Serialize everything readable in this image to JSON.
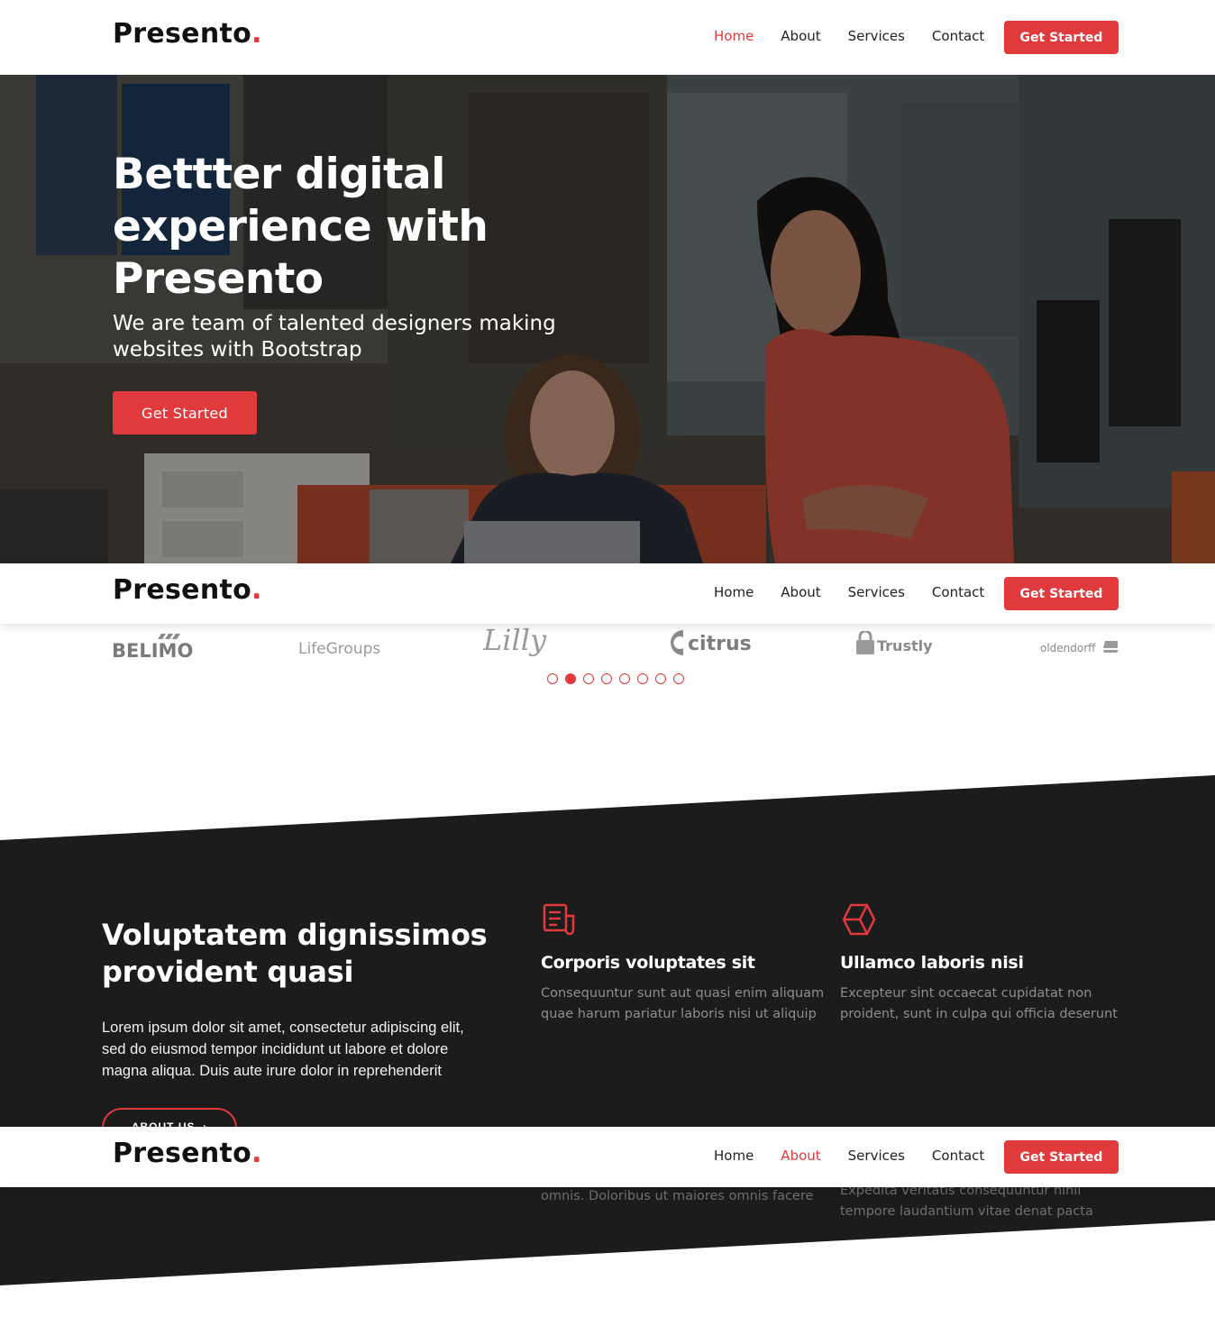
{
  "brand": {
    "name": "Presento",
    "dot": ".",
    "accent_color": "#e03a3c"
  },
  "headers": [
    {
      "nav": [
        "Home",
        "About",
        "Services",
        "Contact"
      ],
      "active": "Home",
      "cta": "Get Started"
    },
    {
      "nav": [
        "Home",
        "About",
        "Services",
        "Contact"
      ],
      "active": "",
      "cta": "Get Started"
    },
    {
      "nav": [
        "Home",
        "About",
        "Services",
        "Contact"
      ],
      "active": "About",
      "cta": "Get Started"
    }
  ],
  "hero": {
    "title": "Bettter digital experience with Presento",
    "subtitle": "We are team of talented designers making websites with Bootstrap",
    "cta": "Get Started"
  },
  "clients": {
    "logos": [
      "BELIMO",
      "LifeGroups",
      "Lilly",
      "citrus",
      "Trustly",
      "oldendorff"
    ],
    "slides_total": 8,
    "active_slide": 2
  },
  "about": {
    "title": "Voluptatem dignissimos provident quasi",
    "lead": "Lorem ipsum dolor sit amet, consectetur adipiscing elit, sed do eiusmod tempor incididunt ut labore et dolore magna aliqua. Duis aute irure dolor in reprehenderit",
    "button": "ABOUT US",
    "features": [
      {
        "icon": "receipt-icon",
        "title": "Corporis voluptates sit",
        "text": "Consequuntur sunt aut quasi enim aliquam quae harum pariatur laboris nisi ut aliquip"
      },
      {
        "icon": "cube-icon",
        "title": "Ullamco laboris nisi",
        "text": "Excepteur sint occaecat cupidatat non proident, sunt in culpa qui officia deserunt"
      }
    ],
    "partial_texts": [
      "omnis. Doloribus ut maiores omnis facere",
      "Expedita veritatis consequuntur nihil tempore laudantium vitae denat pacta"
    ]
  }
}
